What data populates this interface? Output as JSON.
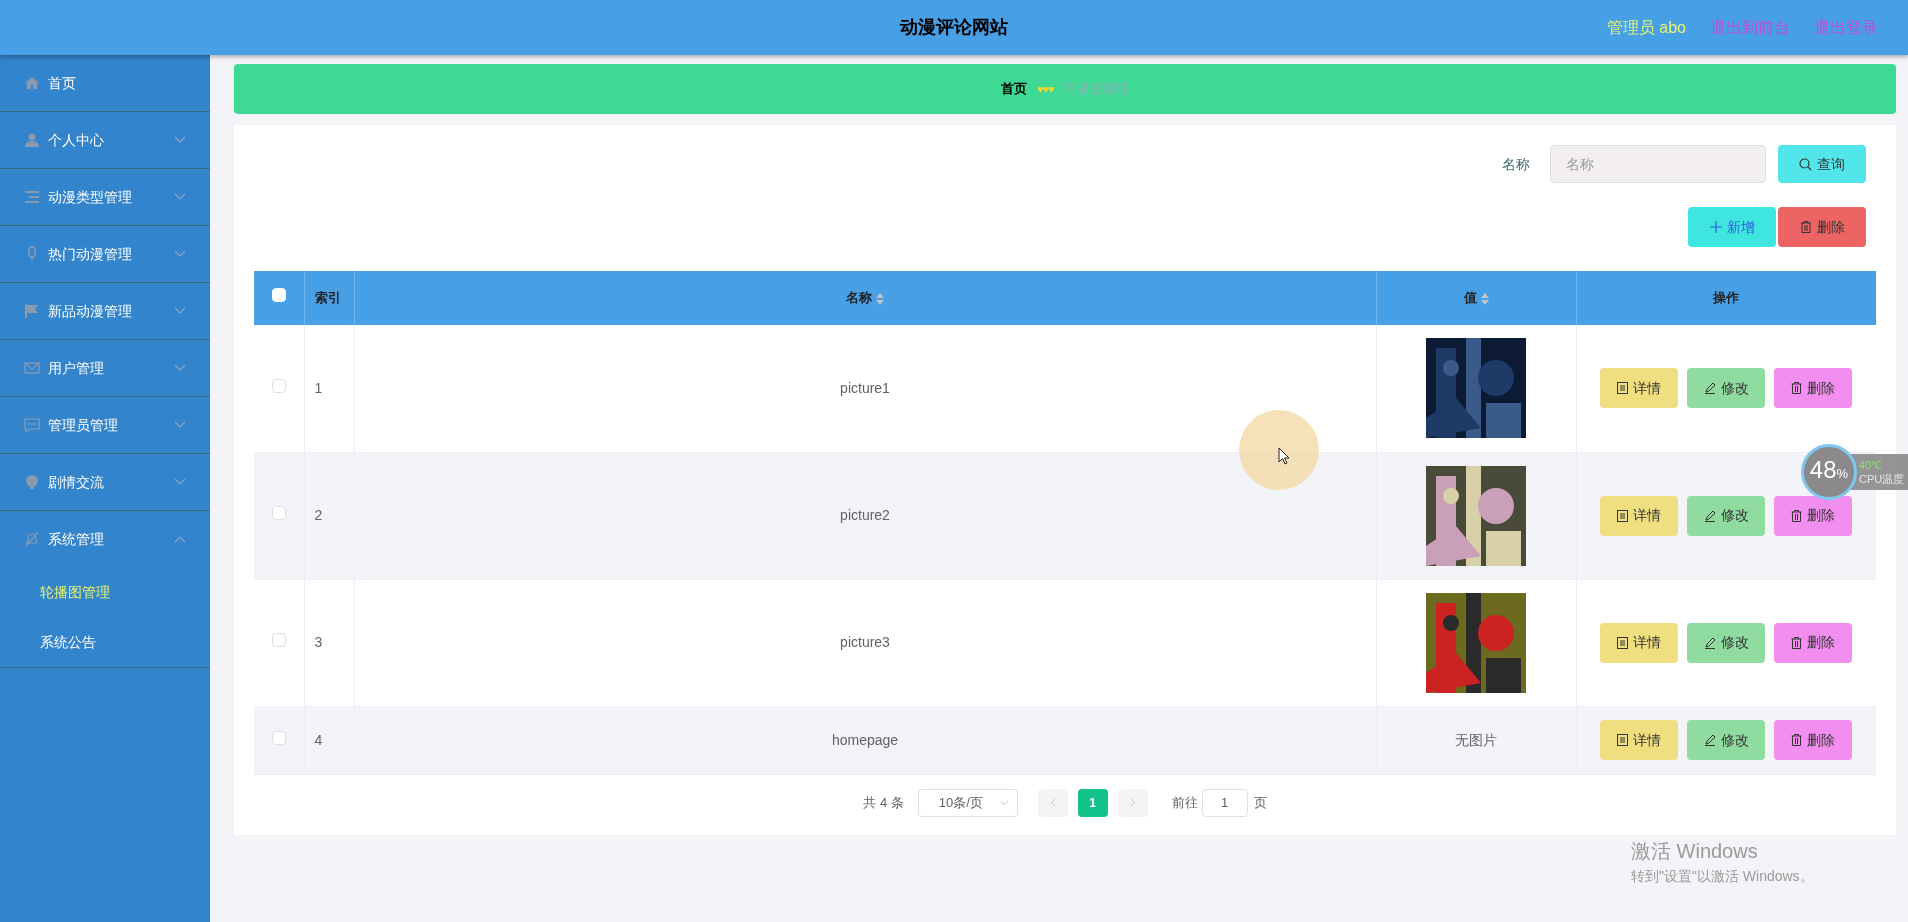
{
  "header": {
    "title": "动漫评论网站",
    "user": "管理员 abo",
    "links": [
      "退出到前台",
      "退出登录"
    ]
  },
  "sidebar": {
    "items": [
      {
        "label": "首页",
        "expandable": false,
        "expanded": false
      },
      {
        "label": "个人中心",
        "expandable": true,
        "expanded": false
      },
      {
        "label": "动漫类型管理",
        "expandable": true,
        "expanded": false
      },
      {
        "label": "热门动漫管理",
        "expandable": true,
        "expanded": false
      },
      {
        "label": "新品动漫管理",
        "expandable": true,
        "expanded": false
      },
      {
        "label": "用户管理",
        "expandable": true,
        "expanded": false
      },
      {
        "label": "管理员管理",
        "expandable": true,
        "expanded": false
      },
      {
        "label": "剧情交流",
        "expandable": true,
        "expanded": false
      },
      {
        "label": "系统管理",
        "expandable": true,
        "expanded": true,
        "children": [
          {
            "label": "轮播图管理",
            "selected": true
          },
          {
            "label": "系统公告",
            "selected": false
          }
        ]
      }
    ]
  },
  "breadcrumb": {
    "home": "首页",
    "separator": "♥♥♥",
    "current": "轮播图管理"
  },
  "search": {
    "label": "名称",
    "placeholder": "名称",
    "button": "查询"
  },
  "actions": {
    "add": "新增",
    "delete": "删除"
  },
  "table": {
    "columns": [
      {
        "label": "索引",
        "sortable": false
      },
      {
        "label": "名称",
        "sortable": true
      },
      {
        "label": "值",
        "sortable": true
      },
      {
        "label": "操作",
        "sortable": false
      }
    ],
    "header_checked": false,
    "rows": [
      {
        "index": "1",
        "name": "picture1",
        "checked": false,
        "value": {
          "kind": "picture"
        },
        "actions": [
          "详情",
          "修改",
          "删除"
        ]
      },
      {
        "index": "2",
        "name": "picture2",
        "checked": false,
        "value": {
          "kind": "picture"
        },
        "actions": [
          "详情",
          "修改",
          "删除"
        ]
      },
      {
        "index": "3",
        "name": "picture3",
        "checked": false,
        "value": {
          "kind": "picture"
        },
        "actions": [
          "详情",
          "修改",
          "删除"
        ]
      },
      {
        "index": "4",
        "name": "homepage",
        "checked": false,
        "value": {
          "kind": "text",
          "text": "无图片"
        },
        "actions": [
          "详情",
          "修改",
          "删除"
        ]
      }
    ]
  },
  "pagination": {
    "total": "共 4 条",
    "page_size": "10条/页",
    "pages": [
      {
        "label": "1",
        "selected": true
      }
    ],
    "goto_label": "前往",
    "goto_value": "1",
    "goto_suffix": "页"
  },
  "cpu_widget": {
    "percent": "48",
    "unit": "%",
    "temperature": "40℃",
    "caption": "CPU温度"
  },
  "os_notice": {
    "title": "激活 Windows",
    "text": "转到\"设置\"以激活 Windows。"
  }
}
